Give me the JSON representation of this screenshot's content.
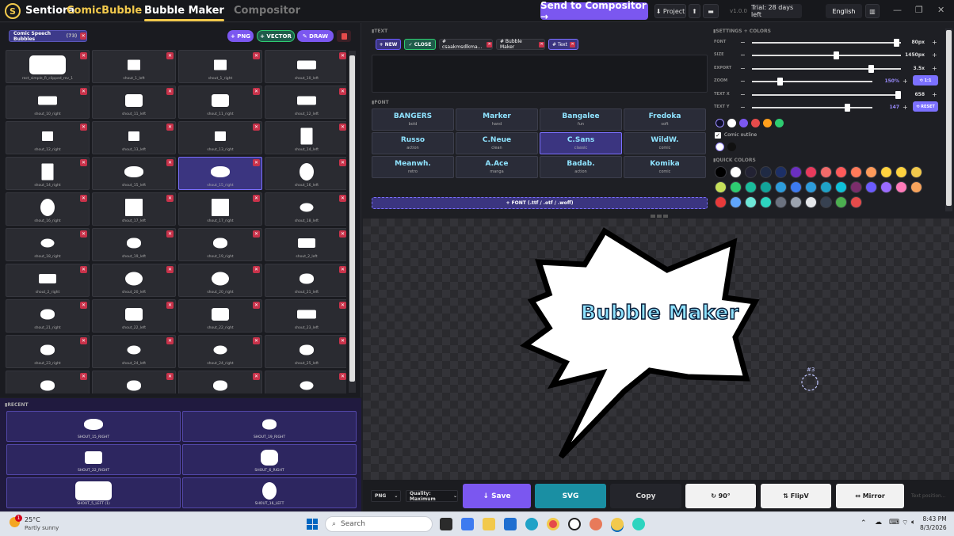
{
  "header": {
    "brand_name": "Sentiora",
    "brand_product": "ComicBubble",
    "logo_letter": "S",
    "tabs": [
      {
        "label": "Bubble Maker",
        "active": true
      },
      {
        "label": "Compositor",
        "active": false
      }
    ],
    "send_button": "Send to Compositor →",
    "project_button": "⬇ Project",
    "upload_icon": "upload-icon",
    "keyboard_icon": "keyboard-icon",
    "version": "v1.0.0",
    "trial": "Trial: 28 days left",
    "language": "English",
    "window": {
      "minimize": "—",
      "maximize": "❐",
      "close": "✕"
    }
  },
  "library": {
    "chip_label": "Comic Speech Bubbles",
    "chip_count": "(73)",
    "buttons": {
      "png": "+ PNG",
      "vector": "+ VECTOR",
      "draw": "✎ DRAW",
      "trash_icon": "trash-icon"
    },
    "items": [
      {
        "label": "rect_simple_R_clipped_rev_1",
        "shape": "rect-wide"
      },
      {
        "label": "shout_1_left",
        "shape": "flag"
      },
      {
        "label": "shout_1_right",
        "shape": "flag"
      },
      {
        "label": "shout_10_left",
        "shape": "rect-small"
      },
      {
        "label": "shout_10_right",
        "shape": "rect-small"
      },
      {
        "label": "shout_11_left",
        "shape": "rect-med"
      },
      {
        "label": "shout_11_right",
        "shape": "rect-med"
      },
      {
        "label": "shout_12_left",
        "shape": "rect-small"
      },
      {
        "label": "shout_12_right",
        "shape": "square-small"
      },
      {
        "label": "shout_13_left",
        "shape": "square-small"
      },
      {
        "label": "shout_13_right",
        "shape": "square-small"
      },
      {
        "label": "shout_14_left",
        "shape": "tall"
      },
      {
        "label": "shout_14_right",
        "shape": "tall"
      },
      {
        "label": "shout_15_left",
        "shape": "burst"
      },
      {
        "label": "shout_15_right",
        "shape": "burst",
        "selected": true
      },
      {
        "label": "shout_16_left",
        "shape": "oval-tall"
      },
      {
        "label": "shout_16_right",
        "shape": "oval-tall"
      },
      {
        "label": "shout_17_left",
        "shape": "square-med"
      },
      {
        "label": "shout_17_right",
        "shape": "square-med"
      },
      {
        "label": "shout_18_left",
        "shape": "oval"
      },
      {
        "label": "shout_18_right",
        "shape": "oval"
      },
      {
        "label": "shout_19_left",
        "shape": "cloud"
      },
      {
        "label": "shout_19_right",
        "shape": "cloud"
      },
      {
        "label": "shout_2_left",
        "shape": "stack"
      },
      {
        "label": "shout_2_right",
        "shape": "stack"
      },
      {
        "label": "shout_20_left",
        "shape": "oval-big"
      },
      {
        "label": "shout_20_right",
        "shape": "oval-big"
      },
      {
        "label": "shout_21_left",
        "shape": "cloud"
      },
      {
        "label": "shout_21_right",
        "shape": "cloud"
      },
      {
        "label": "shout_22_left",
        "shape": "rect-med"
      },
      {
        "label": "shout_22_right",
        "shape": "rect-med"
      },
      {
        "label": "shout_23_left",
        "shape": "rect-small"
      },
      {
        "label": "shout_23_right",
        "shape": "cloud"
      },
      {
        "label": "shout_24_left",
        "shape": "oval"
      },
      {
        "label": "shout_24_right",
        "shape": "oval"
      },
      {
        "label": "shout_25_left",
        "shape": "cloud"
      },
      {
        "label": "",
        "shape": "cloud"
      },
      {
        "label": "",
        "shape": "cloud"
      },
      {
        "label": "",
        "shape": "cloud"
      },
      {
        "label": "",
        "shape": "oval"
      }
    ]
  },
  "recent": {
    "title": "RECENT",
    "items": [
      {
        "label": "SHOUT_15_RIGHT",
        "shape": "burst"
      },
      {
        "label": "SHOUT_19_RIGHT",
        "shape": "cloud"
      },
      {
        "label": "SHOUT_22_RIGHT",
        "shape": "rect-med"
      },
      {
        "label": "SHOUT_6_RIGHT",
        "shape": "burst-big"
      },
      {
        "label": "SHOUT_5_LEFT (1)",
        "shape": "rect-wide"
      },
      {
        "label": "SHOUT_16_LEFT",
        "shape": "oval-tall"
      }
    ]
  },
  "text_panel": {
    "title": "TEXT",
    "new_button": "+ NEW",
    "close_button": "✓ CLOSE",
    "layers": [
      {
        "label": "# csaakmsdlkma...",
        "active": false
      },
      {
        "label": "# Bubble Maker",
        "active": false
      },
      {
        "label": "# Text",
        "active": true
      }
    ]
  },
  "font_panel": {
    "title": "FONT",
    "fonts": [
      {
        "name": "BANGERS",
        "sub": "bold"
      },
      {
        "name": "Marker",
        "sub": "hand"
      },
      {
        "name": "Bangalee",
        "sub": "fun"
      },
      {
        "name": "Fredoka",
        "sub": "soft"
      },
      {
        "name": "Russo",
        "sub": "action"
      },
      {
        "name": "C.Neue",
        "sub": "clean"
      },
      {
        "name": "C.Sans",
        "sub": "classic",
        "selected": true
      },
      {
        "name": "WildW.",
        "sub": "comic"
      },
      {
        "name": "Meanwh.",
        "sub": "retro"
      },
      {
        "name": "A.Ace",
        "sub": "manga"
      },
      {
        "name": "Badab.",
        "sub": "action"
      },
      {
        "name": "Komika",
        "sub": "comic"
      }
    ],
    "add_font": "+ FONT (.ttf / .otf / .woff)"
  },
  "settings": {
    "title": "SETTINGS + COLORS",
    "rows": [
      {
        "label": "FONT",
        "value": "80px",
        "level": 0.99
      },
      {
        "label": "SIZE",
        "value": "1450px",
        "level": 0.57
      },
      {
        "label": "EXPORT",
        "value": "3.5x",
        "level": 0.81
      },
      {
        "label": "ZOOM",
        "value": "150%",
        "level": 0.22,
        "extra": "⟲ 1:1"
      },
      {
        "label": "TEXT X",
        "value": "658",
        "level": 1.0
      },
      {
        "label": "TEXT Y",
        "value": "147",
        "level": 0.81,
        "extra": "⟲ RESET"
      }
    ],
    "text_colors": [
      "#0d0d2a",
      "#ffffff",
      "#7b57f0",
      "#e54b4b",
      "#ff9f1c",
      "#2ecc71"
    ],
    "outline_label": "Comic outline",
    "outline_colors": [
      "#ffffff",
      "#111111"
    ],
    "quick_colors_title": "QUICK COLORS",
    "quick_colors": [
      "#000000",
      "#ffffff",
      "#222233",
      "#1f2a44",
      "#1c2f66",
      "#6a2fbf",
      "#e83a5c",
      "#f06a6a",
      "#ff5a5a",
      "#ff7a5a",
      "#ff9a5a",
      "#ffd23f",
      "#ffd23f",
      "#f2c94c",
      "#c6e05a",
      "#2ecc71",
      "#1abc9c",
      "#12a39a",
      "#2d9cdb",
      "#3d7bf0",
      "#2d9cdb",
      "#1fa2c7",
      "#0fc0d8",
      "#7b2d6b",
      "#6b5bff",
      "#9b6bff",
      "#ff7ab8",
      "#f7a35c",
      "#e83a3a",
      "#60a5fa",
      "#6ee7d8",
      "#2dd4bf",
      "#6b7280",
      "#9ca3af",
      "#e5e7eb",
      "#374151",
      "#4caf50",
      "#e54b4b"
    ]
  },
  "canvas": {
    "bubble_text": "Bubble Maker",
    "marker_label": "#3"
  },
  "bottom_bar": {
    "format": "PNG",
    "quality": "Quality: Maximum",
    "save": "↓ Save",
    "svg": "SVG",
    "copy": "Copy",
    "rotate": "↻ 90°",
    "flipv": "⇅ FlipV",
    "mirror": "⇔ Mirror",
    "text_position": "Text position..."
  },
  "taskbar": {
    "temperature": "25°C",
    "weather": "Partly sunny",
    "search_placeholder": "Search",
    "time": "8:43 PM",
    "date": "8/3/2026"
  }
}
